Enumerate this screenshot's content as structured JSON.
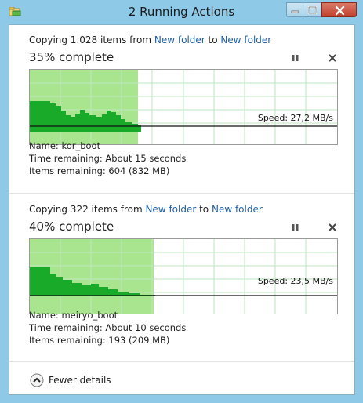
{
  "window": {
    "title": "2 Running Actions"
  },
  "operations": [
    {
      "copy_prefix": "Copying 1.028 items from ",
      "from": "New folder",
      "to_word": " to ",
      "to": "New folder",
      "percent_text": "35% complete",
      "progress": 0.35,
      "speed": "Speed: 27,2 MB/s",
      "name": "Name:  kor_boot",
      "time_remaining": "Time remaining:  About 15 seconds",
      "items_remaining": "Items remaining:  604 (832 MB)"
    },
    {
      "copy_prefix": "Copying 322 items from ",
      "from": "New folder",
      "to_word": " to ",
      "to": "New folder",
      "percent_text": "40% complete",
      "progress": 0.4,
      "speed": "Speed: 23,5 MB/s",
      "name": "Name:  meiryo_boot",
      "time_remaining": "Time remaining:  About 10 seconds",
      "items_remaining": "Items remaining:  193 (209 MB)"
    }
  ],
  "footer": {
    "fewer_details": "Fewer details"
  },
  "colors": {
    "progress_fill": "#a8e58e",
    "speed_fill": "#1aaa2a",
    "grid": "#bfe6c1",
    "link": "#1c5fa5"
  }
}
